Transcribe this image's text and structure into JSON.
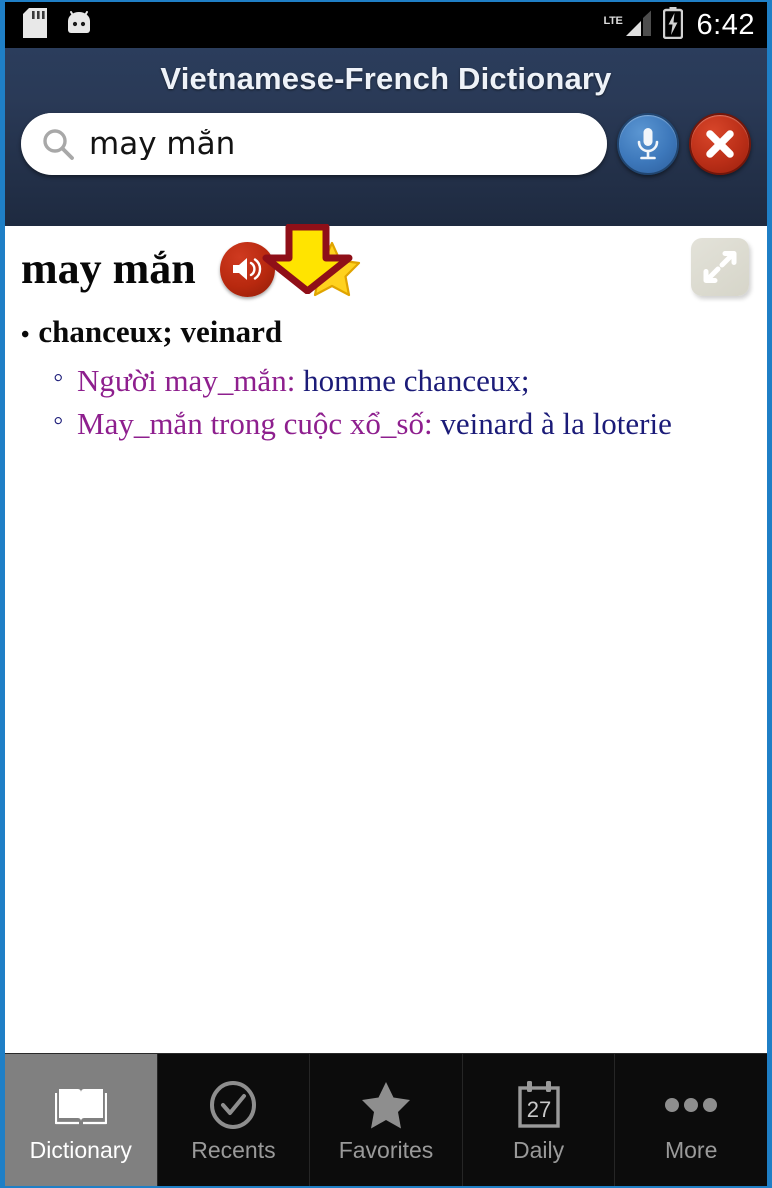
{
  "statusbar": {
    "time": "6:42",
    "network_label": "LTE",
    "icons": [
      "sd-card-icon",
      "android-robot-icon",
      "lte-signal-icon",
      "battery-charging-icon"
    ]
  },
  "header": {
    "title": "Vietnamese-French Dictionary",
    "accent_color": "#2a3a57"
  },
  "search": {
    "value": "may mắn",
    "placeholder": "",
    "icon": "search-icon",
    "mic_label": "mic-icon",
    "clear_label": "close-icon"
  },
  "annotation": {
    "type": "arrow-down",
    "fill_color": "#ffe400",
    "stroke_color": "#8f0f18",
    "points_to": "pronounce-button"
  },
  "entry": {
    "headword": "may mắn",
    "pronounce_icon": "speaker-icon",
    "favorite_icon": "star-icon",
    "expand_icon": "expand-icon",
    "senses": [
      {
        "bullet": "•",
        "text": "chanceux; veinard"
      }
    ],
    "examples": [
      {
        "source": "Người may_mắn: ",
        "target": "homme chanceux;"
      },
      {
        "source": "May_mắn trong cuộc xổ_số: ",
        "target": "veinard à la loterie"
      }
    ],
    "source_color": "#8e1f8e",
    "target_color": "#1b1b78"
  },
  "tabbar": {
    "items": [
      {
        "label": "Dictionary",
        "icon": "book-icon",
        "active": true
      },
      {
        "label": "Recents",
        "icon": "check-circle-icon",
        "active": false
      },
      {
        "label": "Favorites",
        "icon": "star-icon",
        "active": false
      },
      {
        "label": "Daily",
        "icon": "calendar-icon",
        "active": false
      },
      {
        "label": "More",
        "icon": "ellipsis-icon",
        "active": false
      }
    ],
    "calendar_day": "27"
  }
}
